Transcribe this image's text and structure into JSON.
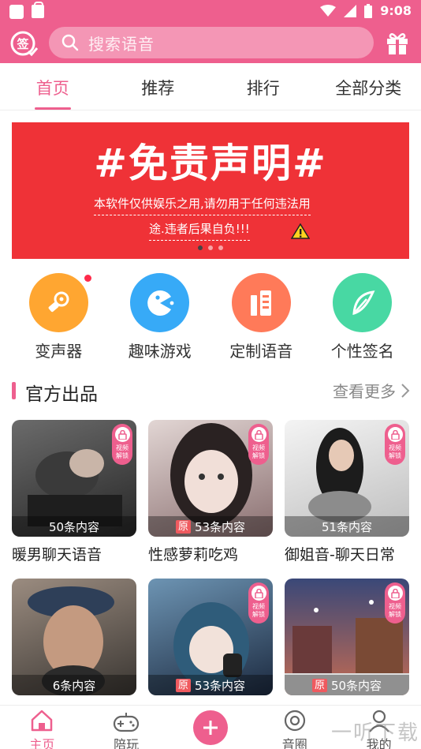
{
  "status_bar": {
    "time": "9:08"
  },
  "header": {
    "search_placeholder": "搜索语音",
    "sign_label": "签"
  },
  "tabs": [
    {
      "label": "首页",
      "active": true
    },
    {
      "label": "推荐",
      "active": false
    },
    {
      "label": "排行",
      "active": false
    },
    {
      "label": "全部分类",
      "active": false
    }
  ],
  "banner": {
    "title": "#免责声明#",
    "line1": "本软件仅供娱乐之用,请勿用于任何违法用",
    "line2": "途.违者后果自负!!!",
    "page_count": 3,
    "active_page": 1
  },
  "features": [
    {
      "label": "变声器",
      "icon": "voice-changer-icon",
      "color": "#ffa631",
      "badge": true
    },
    {
      "label": "趣味游戏",
      "icon": "game-icon",
      "color": "#37aaf7",
      "badge": false
    },
    {
      "label": "定制语音",
      "icon": "custom-voice-icon",
      "color": "#ff7a59",
      "badge": false
    },
    {
      "label": "个性签名",
      "icon": "signature-icon",
      "color": "#48d8a3",
      "badge": false
    }
  ],
  "section": {
    "title": "官方出品",
    "more": "查看更多"
  },
  "lock_text": "视频解锁",
  "cards": [
    {
      "title": "暖男聊天语音",
      "count": "50条内容",
      "original": false,
      "original_label": "",
      "bg": [
        "#5a5a5a",
        "#2b2b2b"
      ]
    },
    {
      "title": "性感萝莉吃鸡",
      "count": "53条内容",
      "original": true,
      "original_label": "原",
      "bg": [
        "#d8c8c6",
        "#8a6f70"
      ]
    },
    {
      "title": "御姐音-聊天日常",
      "count": "51条内容",
      "original": false,
      "original_label": "",
      "bg": [
        "#f2f2f2",
        "#b9b9b9"
      ]
    },
    {
      "title": "",
      "count": "6条内容",
      "original": false,
      "original_label": "",
      "bg": [
        "#8b7d72",
        "#3e3a36"
      ]
    },
    {
      "title": "",
      "count": "53条内容",
      "original": true,
      "original_label": "原",
      "bg": [
        "#5b86a8",
        "#1e2e44"
      ]
    },
    {
      "title": "",
      "count": "50条内容",
      "original": true,
      "original_label": "原",
      "bg": [
        "#3c4a7a",
        "#c26850"
      ]
    }
  ],
  "bottom_nav": [
    {
      "label": "主页",
      "icon": "home-icon",
      "active": true
    },
    {
      "label": "陪玩",
      "icon": "gamepad-icon",
      "active": false
    },
    {
      "label": "",
      "icon": "plus-icon",
      "active": false
    },
    {
      "label": "音圈",
      "icon": "audio-circle-icon",
      "active": false
    },
    {
      "label": "我的",
      "icon": "profile-icon",
      "active": false
    }
  ],
  "watermark": "一听下载"
}
